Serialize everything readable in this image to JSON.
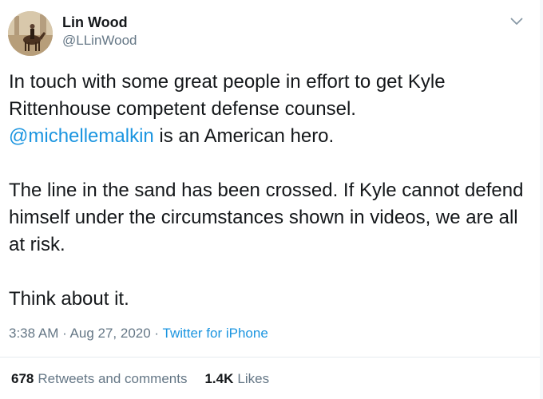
{
  "author": {
    "display_name": "Lin Wood",
    "handle": "@LLinWood"
  },
  "tweet": {
    "paragraphs": [
      {
        "line1": "In touch with some great people in effort to get Kyle",
        "line2": "Rittenhouse competent defense counsel.",
        "mention": "@michellemalkin",
        "after_mention": " is an American hero."
      },
      {
        "text": "The line in the sand has been crossed. If Kyle cannot defend himself under the circumstances shown in videos, we are all at risk."
      },
      {
        "text": "Think about it."
      }
    ],
    "time": "3:38 AM",
    "date": "Aug 27, 2020",
    "separator": " · ",
    "source": "Twitter for iPhone"
  },
  "stats": {
    "retweets_count": "678",
    "retweets_label": "Retweets and comments",
    "likes_count": "1.4K",
    "likes_label": "Likes"
  },
  "colors": {
    "link": "#1b95e0",
    "secondary_text": "#657786",
    "primary_text": "#14171a"
  },
  "icons": {
    "caret": "chevron-down-icon",
    "avatar": "profile-photo"
  }
}
